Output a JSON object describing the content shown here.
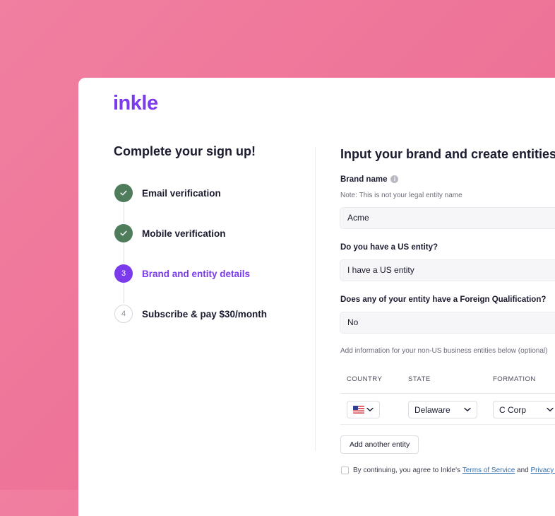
{
  "brand": {
    "logo_text": "inkle",
    "color": "#7c3aed"
  },
  "left": {
    "title": "Complete your sign up!",
    "steps": [
      {
        "number": "",
        "label": "Email verification",
        "status": "done"
      },
      {
        "number": "",
        "label": "Mobile verification",
        "status": "done"
      },
      {
        "number": "3",
        "label": "Brand and entity details",
        "status": "active"
      },
      {
        "number": "4",
        "label": "Subscribe & pay $30/month",
        "status": "pending"
      }
    ]
  },
  "form": {
    "title": "Input your brand and create entities",
    "brand_name": {
      "label": "Brand name",
      "info_icon": "i",
      "note": "Note: This is not your legal entity name",
      "value": "Acme"
    },
    "us_entity": {
      "label": "Do you have a US entity?",
      "value": "I have a US entity"
    },
    "foreign_qualification": {
      "label": "Does any of your entity have a Foreign Qualification?",
      "value": "No"
    },
    "non_us_note": "Add information for your non-US business entities below (optional)",
    "table": {
      "headers": [
        "COUNTRY",
        "STATE",
        "FORMATION"
      ],
      "row": {
        "country_flag": "us-flag-icon",
        "state": "Delaware",
        "formation": "C Corp"
      }
    },
    "add_entity_button": "Add another entity",
    "consent": {
      "text": "By continuing, you agree to Inkle's",
      "terms_link": "Terms of Service",
      "and": "and",
      "privacy_link": "Privacy Policy"
    }
  },
  "colors": {
    "background": "#ee7398",
    "done": "#4f7d5c",
    "active": "#7c3aed",
    "link": "#2f6fb0"
  }
}
